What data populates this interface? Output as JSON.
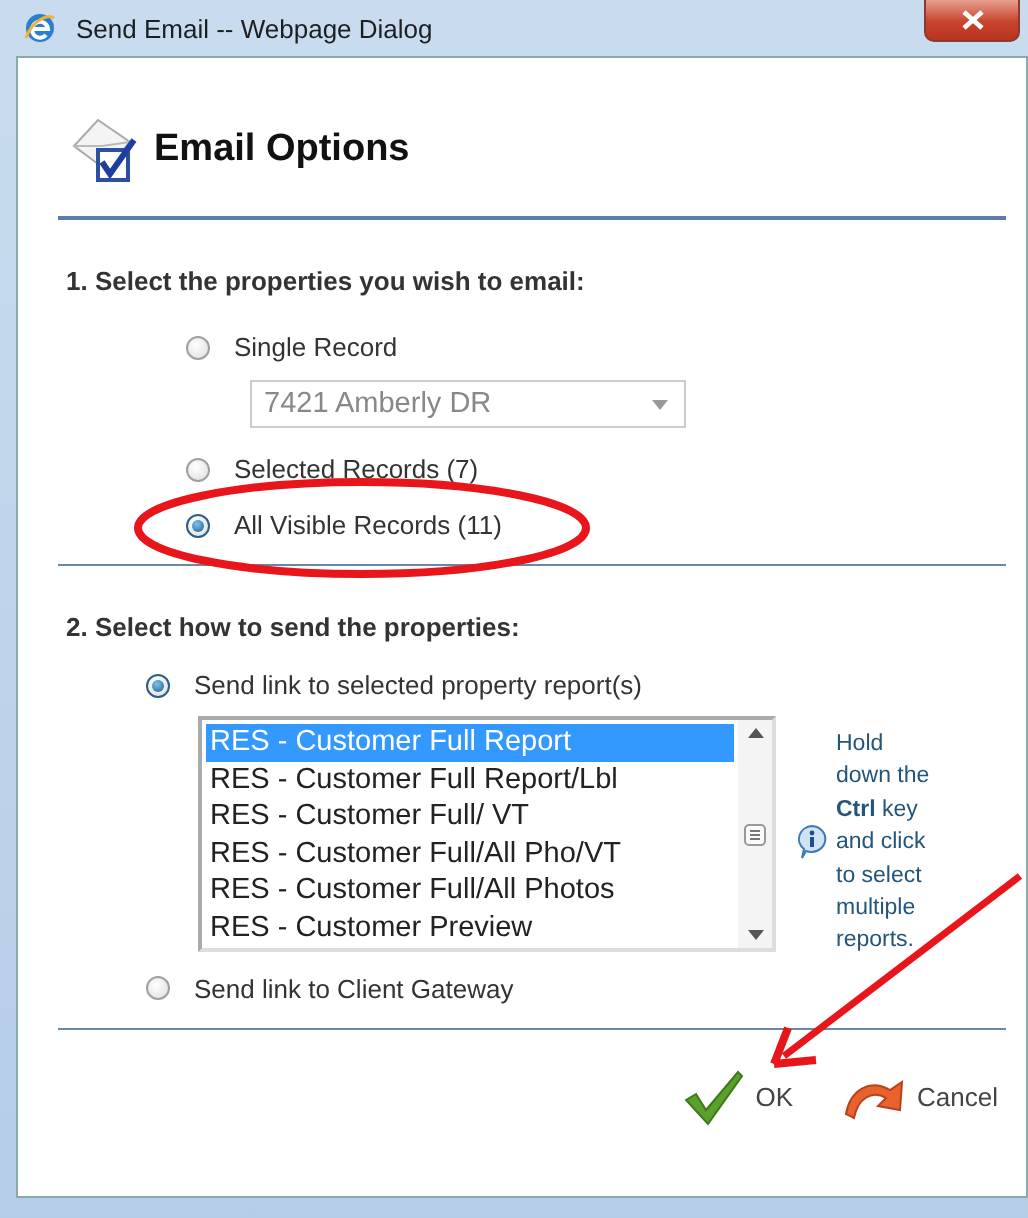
{
  "window": {
    "title": "Send Email -- Webpage Dialog"
  },
  "header": {
    "title": "Email Options"
  },
  "section_1": {
    "heading": "1. Select the properties you wish to email:",
    "options": [
      {
        "label": "Single Record",
        "selected": false,
        "kind": "dropdown",
        "dropdown": {
          "value": "7421 Amberly DR",
          "disabled": true
        }
      },
      {
        "label": "Selected Records (7)",
        "selected": false,
        "kind": "plain"
      },
      {
        "label": "All Visible Records (11)",
        "selected": true,
        "kind": "plain"
      }
    ]
  },
  "section_2": {
    "heading": "2. Select how to send the properties:",
    "options": [
      {
        "label": "Send link to selected property report(s)",
        "selected": true,
        "kind": "listbox",
        "listbox": {
          "items": [
            {
              "label": "RES - Customer Full Report",
              "selected": true
            },
            {
              "label": "RES - Customer Full Report/Lbl",
              "selected": false
            },
            {
              "label": "RES - Customer Full/ VT",
              "selected": false
            },
            {
              "label": "RES - Customer Full/All Pho/VT",
              "selected": false
            },
            {
              "label": "RES - Customer Full/All Photos",
              "selected": false
            },
            {
              "label": "RES - Customer Preview",
              "selected": false
            }
          ]
        },
        "hint": "Hold down the **Ctrl** key and click to select multiple reports."
      },
      {
        "label": "Send link to Client Gateway",
        "selected": false,
        "kind": "plain"
      }
    ]
  },
  "buttons": [
    {
      "label": "OK",
      "kind": "ok"
    },
    {
      "label": "Cancel",
      "kind": "cancel"
    }
  ],
  "annotation": {
    "highlight_ellipse": true,
    "pointer_arrow": true
  }
}
